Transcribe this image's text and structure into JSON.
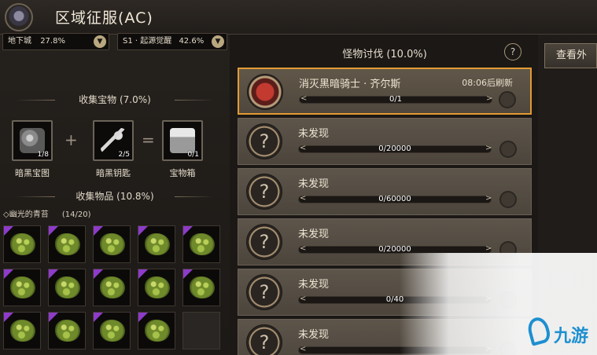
{
  "header": {
    "title": "区域征服(AC)"
  },
  "left": {
    "dropdowns": [
      {
        "label": "地下城",
        "percent": "27.8%"
      },
      {
        "label": "S1 · 起源觉醒",
        "percent": "42.6%"
      }
    ],
    "treasure_section": "收集宝物 (7.0%)",
    "treasures": [
      {
        "name": "暗黑宝图",
        "count": "1/8"
      },
      {
        "name": "暗黑钥匙",
        "count": "2/5"
      },
      {
        "name": "宝物箱",
        "count": "0/1"
      }
    ],
    "operators": {
      "plus": "+",
      "equals": "="
    },
    "items_section": "收集物品 (10.8%)",
    "collect_group": {
      "name": "◇幽光的青苔",
      "count": "(14/20)"
    }
  },
  "middle": {
    "title": "怪物讨伐 (10.0%)",
    "help": "?",
    "rows": [
      {
        "name": "消灭黑暗骑士 · 齐尔斯",
        "timer": "08:06后刷新",
        "progress": "0/1",
        "boss": true
      },
      {
        "name": "未发现",
        "timer": "",
        "progress": "0/20000",
        "boss": false
      },
      {
        "name": "未发现",
        "timer": "",
        "progress": "0/60000",
        "boss": false
      },
      {
        "name": "未发现",
        "timer": "",
        "progress": "0/20000",
        "boss": false
      },
      {
        "name": "未发现",
        "timer": "",
        "progress": "0/40",
        "boss": false
      },
      {
        "name": "未发现",
        "timer": "",
        "progress": "",
        "boss": false
      }
    ]
  },
  "right": {
    "button": "查看外"
  },
  "watermark": {
    "text": "九游"
  }
}
